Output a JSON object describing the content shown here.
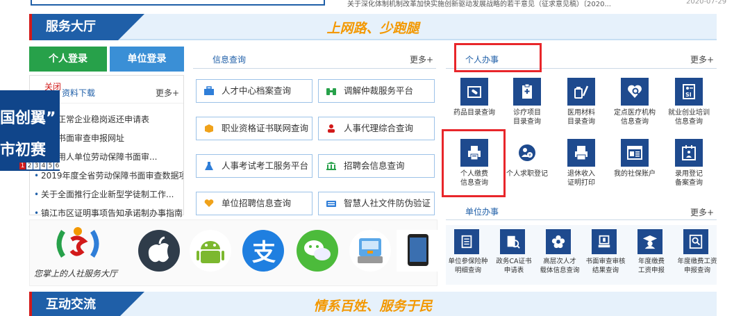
{
  "top_news": {
    "text": "关于深化体制机制改革加快实施创新驱动发展战略的若干意见（征求意见稿）〔2020...",
    "date": "2020-07-29"
  },
  "service_hall": {
    "title": "服务大厅",
    "slogan": "上网路、少跑腿"
  },
  "login": {
    "personal": "个人登录",
    "unit": "单位登录"
  },
  "downloads": {
    "title": "资料下载",
    "more": "更多+",
    "close": "关闭",
    "items": [
      "民营正常企业稳岗返还申请表",
      "统一书面审查申报网址",
      "年度用人单位劳动保障书面审...",
      "2019年度全省劳动保障书面审查数据项",
      "关于全面推行企业新型学徒制工作...",
      "镇江市区证明事项告知承诺制办事指南"
    ]
  },
  "float_ad": {
    "line1": "国创翼”",
    "line2": "市初赛",
    "pages": [
      "1",
      "2",
      "3",
      "4",
      "5",
      "6"
    ]
  },
  "info_query": {
    "title": "信息查询",
    "more": "更多+",
    "buttons": [
      "人才中心档案查询",
      "调解仲裁服务平台",
      "职业资格证书联网查询",
      "人事代理综合查询",
      "人事考试考工服务平台",
      "招聘会信息查询",
      "单位招聘信息查询",
      "智慧人社文件防伪验证"
    ]
  },
  "personal_affairs": {
    "title": "个人办事",
    "more": "更多+",
    "row1": [
      {
        "label": [
          "药品目录查询"
        ],
        "icon": "medicine-icon"
      },
      {
        "label": [
          "诊疗项目",
          "目录查询"
        ],
        "icon": "clipboard-icon"
      },
      {
        "label": [
          "医用材料",
          "目录查询"
        ],
        "icon": "syringe-icon"
      },
      {
        "label": [
          "定点医疗机构",
          "信息查询"
        ],
        "icon": "heart-search-icon"
      },
      {
        "label": [
          "就业创业培训",
          "信息查询"
        ],
        "icon": "si-card-icon"
      }
    ],
    "row2": [
      {
        "label": [
          "个人缴费",
          "信息查询"
        ],
        "icon": "printer-icon"
      },
      {
        "label": [
          "个人求职登记"
        ],
        "icon": "job-seek-icon"
      },
      {
        "label": [
          "退休收入",
          "证明打印"
        ],
        "icon": "print-doc-icon"
      },
      {
        "label": [
          "我的社保账户"
        ],
        "icon": "account-card-icon"
      },
      {
        "label": [
          "录用登记",
          "备案查询"
        ],
        "icon": "calendar-icon"
      }
    ]
  },
  "unit_affairs": {
    "title": "单位办事",
    "more": "更多+",
    "items": [
      {
        "label": [
          "单位参保险种",
          "明细查询"
        ],
        "icon": "document-icon"
      },
      {
        "label": [
          "政务CA证书",
          "申请表"
        ],
        "icon": "certificate-icon"
      },
      {
        "label": [
          "高层次人才",
          "载体信息查询"
        ],
        "icon": "flower-icon"
      },
      {
        "label": [
          "书面审查审核",
          "结果查询"
        ],
        "icon": "stamp-icon"
      },
      {
        "label": [
          "年度缴费",
          "工资申报"
        ],
        "icon": "graduate-icon"
      },
      {
        "label": [
          "年度缴费工资",
          "申报查询"
        ],
        "icon": "search-doc-icon"
      }
    ]
  },
  "promo": {
    "tagline": "您掌上的人社服务大厅"
  },
  "interaction": {
    "title": "互动交流",
    "slogan": "情系百姓、服务于民"
  },
  "colors": {
    "brand_blue": "#1f5fa8",
    "icon_blue": "#1e4a8e",
    "highlight_red": "#e8262a",
    "slogan_orange": "#f39800",
    "login_green": "#27a14a"
  }
}
